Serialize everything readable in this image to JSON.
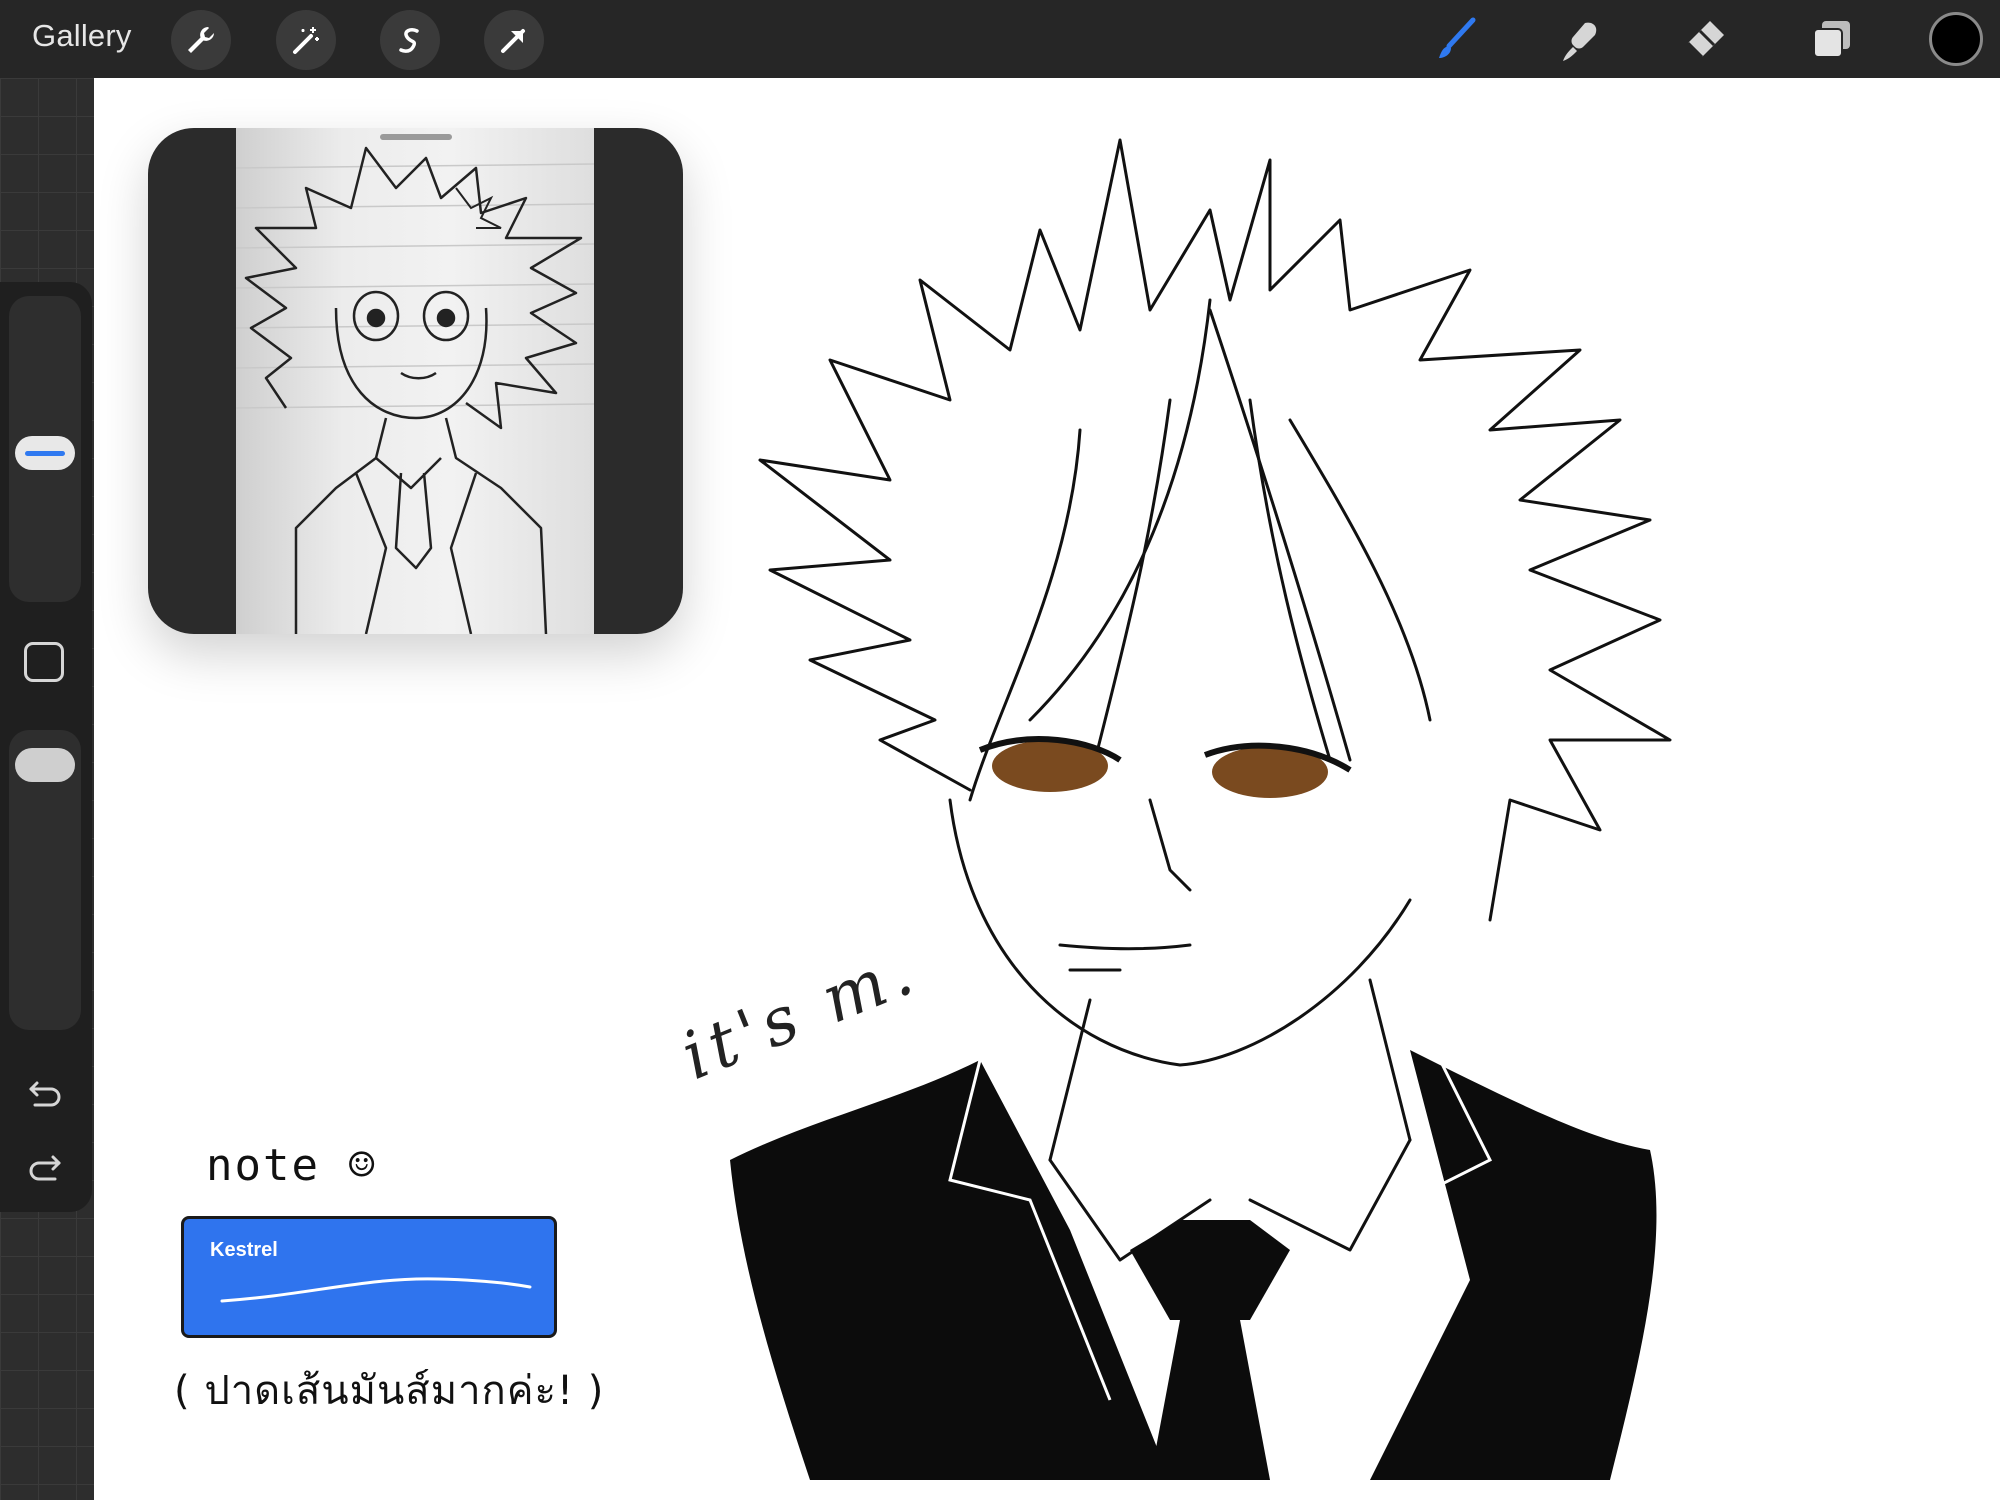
{
  "toolbar": {
    "gallery_label": "Gallery",
    "left_tools": [
      "wrench-icon",
      "magic-wand-icon",
      "selection-icon",
      "transform-arrow-icon"
    ],
    "right_tools": [
      "brush-icon",
      "smudge-icon",
      "eraser-icon",
      "layers-icon"
    ],
    "active_tool": "brush-icon",
    "accent_color": "#2f79f0",
    "current_color": "#000000"
  },
  "sidebar": {
    "tools": [
      "brush-size-slider",
      "modify-button",
      "opacity-slider",
      "undo-icon",
      "redo-icon"
    ]
  },
  "canvas": {
    "note_label": "note ☺",
    "brush_card": {
      "name": "Kestrel",
      "color": "#2f74ee"
    },
    "caption": "( ปาดเส้นมันส์มากค่ะ! )",
    "signature": "it's m."
  }
}
